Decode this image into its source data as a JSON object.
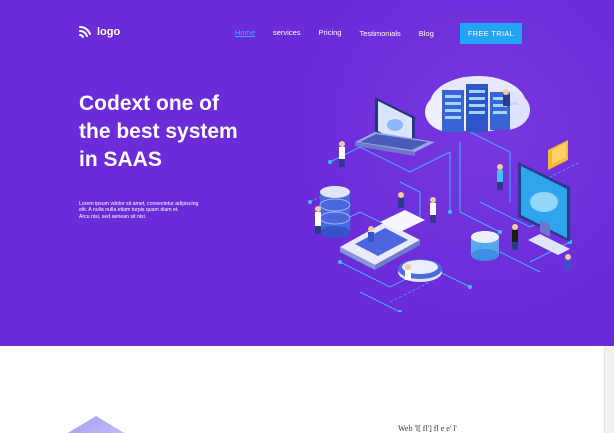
{
  "brand": {
    "logo_text": "logo"
  },
  "nav": {
    "items": [
      {
        "label": "Home",
        "active": true
      },
      {
        "label": "services",
        "active": false
      },
      {
        "label": "Pricing",
        "active": false
      },
      {
        "label": "Testimonials",
        "active": false
      },
      {
        "label": "Blog",
        "active": false
      }
    ],
    "cta_label": "FREE TRIAL"
  },
  "hero": {
    "headline_lines": [
      "Codext one of",
      "the best system",
      "in SAAS"
    ],
    "paragraph_lines": [
      "Lorem ipsum vdolor sit amet, consectetur adipiscing",
      "elit. A nulla nulla etiam turpis quam diam et.",
      "Arcu nisi, sed aenean sit nisi."
    ]
  },
  "lower": {
    "partial_text": "Web 'l[ fl'] fl e e' l'"
  },
  "colors": {
    "hero_bg": "#6b2bd9",
    "accent": "#24a4f5",
    "active_nav": "#2fb5ff"
  }
}
